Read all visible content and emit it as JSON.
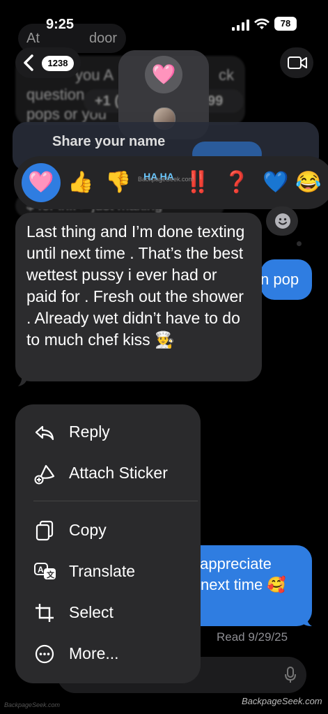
{
  "status_bar": {
    "time": "9:25",
    "battery": "78"
  },
  "conversation": {
    "title_partial": "At",
    "title_partial_right": "door",
    "back_badge": "1238",
    "background_text_1": "you A",
    "background_text_2": "question",
    "background_text_3": "pops or you",
    "background_text_4": "ck",
    "background_count": "+1 (",
    "background_count_2": "99",
    "background_line_partial": "$ for infi > just making",
    "blue_peek_text": "n pop",
    "bottom_blue_line1": "v appreciate",
    "bottom_blue_line2": "next time 🥰",
    "read_receipt": "Read 9/29/25"
  },
  "share_banner": {
    "title": "Share your name"
  },
  "tapbacks": [
    {
      "name": "heart",
      "glyph": "🩷",
      "selected": true
    },
    {
      "name": "thumbs-up",
      "glyph": "👍"
    },
    {
      "name": "thumbs-down",
      "glyph": "👎"
    },
    {
      "name": "haha",
      "glyph": "HA HA"
    },
    {
      "name": "emphasize",
      "glyph": "‼️"
    },
    {
      "name": "question",
      "glyph": "❓"
    },
    {
      "name": "blue-heart",
      "glyph": "💙"
    },
    {
      "name": "laugh",
      "glyph": "😂"
    }
  ],
  "message": {
    "text": "Last thing and I’m done texting until next time . That’s the  best wettest pussy i ever had or paid for . Fresh out the shower . Already wet didn’t have to do to much  chef kiss 👨‍🍳"
  },
  "menu": {
    "items": [
      {
        "label": "Reply",
        "icon": "reply-icon"
      },
      {
        "label": "Attach Sticker",
        "icon": "sticker-icon"
      },
      {
        "label": "Copy",
        "icon": "copy-icon"
      },
      {
        "label": "Translate",
        "icon": "translate-icon"
      },
      {
        "label": "Select",
        "icon": "crop-select-icon"
      },
      {
        "label": "More...",
        "icon": "more-icon"
      }
    ]
  },
  "watermark": {
    "main": "BackpageSeek.com",
    "corner": "BackpageSeek.com",
    "tapback_overlay": "BackpageSeek.com"
  },
  "colors": {
    "accent": "#2f7de1",
    "bubble_gray": "#2c2c2e",
    "menu_bg": "#2a2a2c"
  }
}
